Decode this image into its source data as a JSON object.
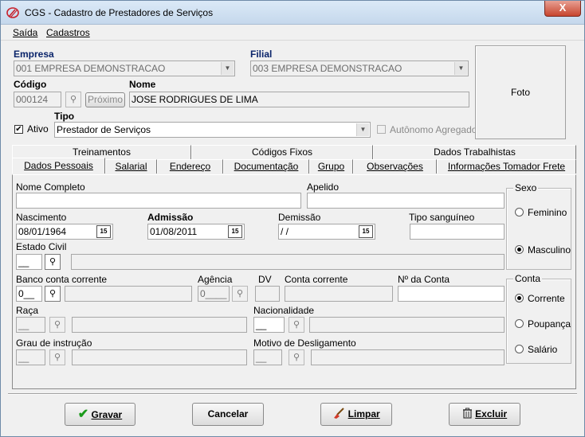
{
  "window": {
    "title": "CGS - Cadastro de Prestadores de Serviços",
    "close_glyph": "X"
  },
  "menu": [
    {
      "label": "Saída"
    },
    {
      "label": "Cadastros"
    }
  ],
  "header": {
    "empresa_label": "Empresa",
    "empresa_value": "001 EMPRESA DEMONSTRACAO",
    "filial_label": "Filial",
    "filial_value": "003 EMPRESA DEMONSTRACAO",
    "codigo_label": "Código",
    "codigo_value": "000124",
    "proximo_label": "Próximo",
    "nome_label": "Nome",
    "nome_value": "JOSE RODRIGUES  DE LIMA",
    "ativo_label": "Ativo",
    "ativo_checked": true,
    "tipo_label": "Tipo",
    "tipo_value": "Prestador de Serviços",
    "autonomo_label": "Autônomo Agregado",
    "foto_label": "Foto"
  },
  "tabs_row1": [
    "Treinamentos",
    "Códigos Fixos",
    "Dados Trabalhistas"
  ],
  "tabs_row2": [
    "Dados Pessoais",
    "Salarial",
    "Endereço",
    "Documentação",
    "Grupo",
    "Observações",
    "Informações Tomador Frete"
  ],
  "pessoais": {
    "nome_completo_label": "Nome Completo",
    "nome_completo_value": "",
    "apelido_label": "Apelido",
    "apelido_value": "",
    "nascimento_label": "Nascimento",
    "nascimento_value": "08/01/1964",
    "admissao_label": "Admissão",
    "admissao_value": "01/08/2011",
    "demissao_label": "Demissão",
    "demissao_value": " / /",
    "tipo_sanguineo_label": "Tipo sanguíneo",
    "tipo_sanguineo_value": "",
    "estado_civil_label": "Estado Civil",
    "estado_civil_value": "__",
    "banco_label": "Banco conta corrente",
    "banco_value": "0__",
    "agencia_label": "Agência",
    "agencia_value": "0____",
    "dv_label": "DV",
    "conta_corrente_label": "Conta corrente",
    "nro_conta_label": "Nº da Conta",
    "raca_label": "Raça",
    "raca_value": "__",
    "nacionalidade_label": "Nacionalidade",
    "nacionalidade_value": "__",
    "grau_label": "Grau de instrução",
    "grau_value": "__",
    "motivo_label": "Motivo de Desligamento",
    "motivo_value": "__",
    "calendar_glyph": "15"
  },
  "sexo": {
    "title": "Sexo",
    "options": [
      "Feminino",
      "Masculino"
    ],
    "selected": "Masculino"
  },
  "conta": {
    "title": "Conta",
    "options": [
      "Corrente",
      "Poupança",
      "Salário"
    ],
    "selected": "Corrente"
  },
  "buttons": {
    "gravar": "Gravar",
    "cancelar": "Cancelar",
    "limpar": "Limpar",
    "excluir": "Excluir"
  },
  "colors": {
    "close_red": "#c7452e",
    "label_blue": "#0a246a",
    "check_green": "#1a9a1a"
  }
}
